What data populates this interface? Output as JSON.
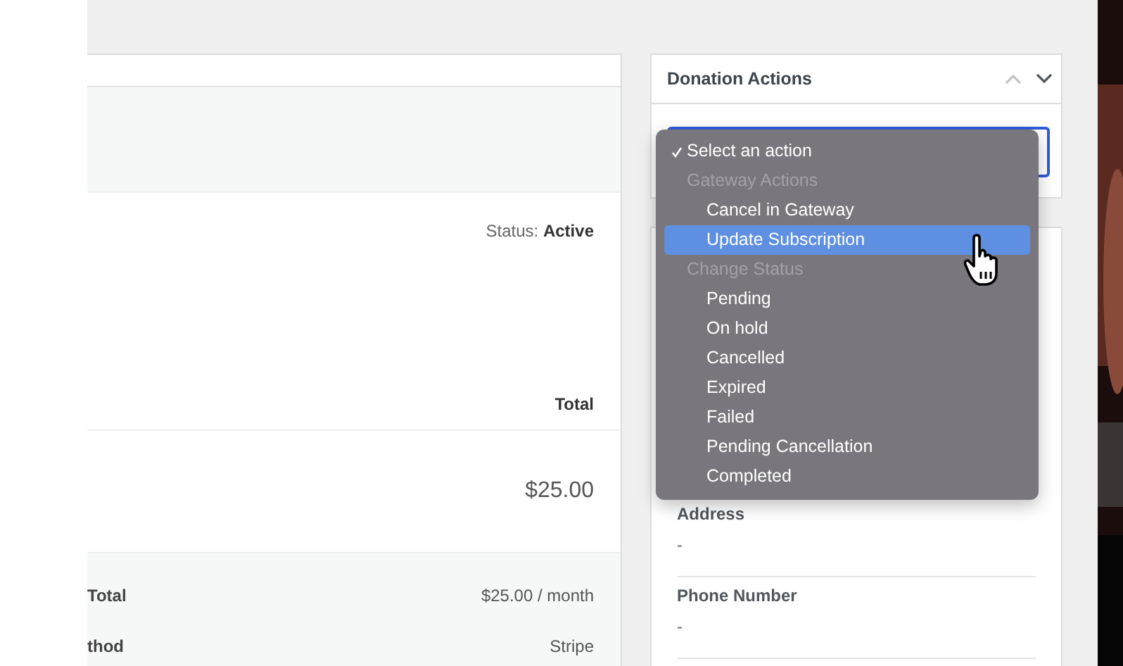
{
  "order_panel": {
    "status_label": "Status:",
    "status_value": "Active",
    "total_heading": "Total",
    "item_amount": "$25.00",
    "summary_rows": [
      {
        "label": "Total",
        "value": "$25.00 / month"
      },
      {
        "label": "thod",
        "value": "Stripe"
      }
    ]
  },
  "donation_actions": {
    "title": "Donation Actions",
    "menu": [
      {
        "kind": "option",
        "label": "Select an action",
        "checked": true,
        "selected": false
      },
      {
        "kind": "group",
        "label": "Gateway Actions"
      },
      {
        "kind": "option",
        "label": "Cancel in Gateway",
        "checked": false,
        "selected": false
      },
      {
        "kind": "option",
        "label": "Update Subscription",
        "checked": false,
        "selected": true
      },
      {
        "kind": "group",
        "label": "Change Status"
      },
      {
        "kind": "option",
        "label": "Pending",
        "checked": false,
        "selected": false
      },
      {
        "kind": "option",
        "label": "On hold",
        "checked": false,
        "selected": false
      },
      {
        "kind": "option",
        "label": "Cancelled",
        "checked": false,
        "selected": false
      },
      {
        "kind": "option",
        "label": "Expired",
        "checked": false,
        "selected": false
      },
      {
        "kind": "option",
        "label": "Failed",
        "checked": false,
        "selected": false
      },
      {
        "kind": "option",
        "label": "Pending Cancellation",
        "checked": false,
        "selected": false
      },
      {
        "kind": "option",
        "label": "Completed",
        "checked": false,
        "selected": false
      }
    ]
  },
  "donor_fields": [
    {
      "label": "Address",
      "value": "-"
    },
    {
      "label": "Phone Number",
      "value": "-"
    }
  ]
}
